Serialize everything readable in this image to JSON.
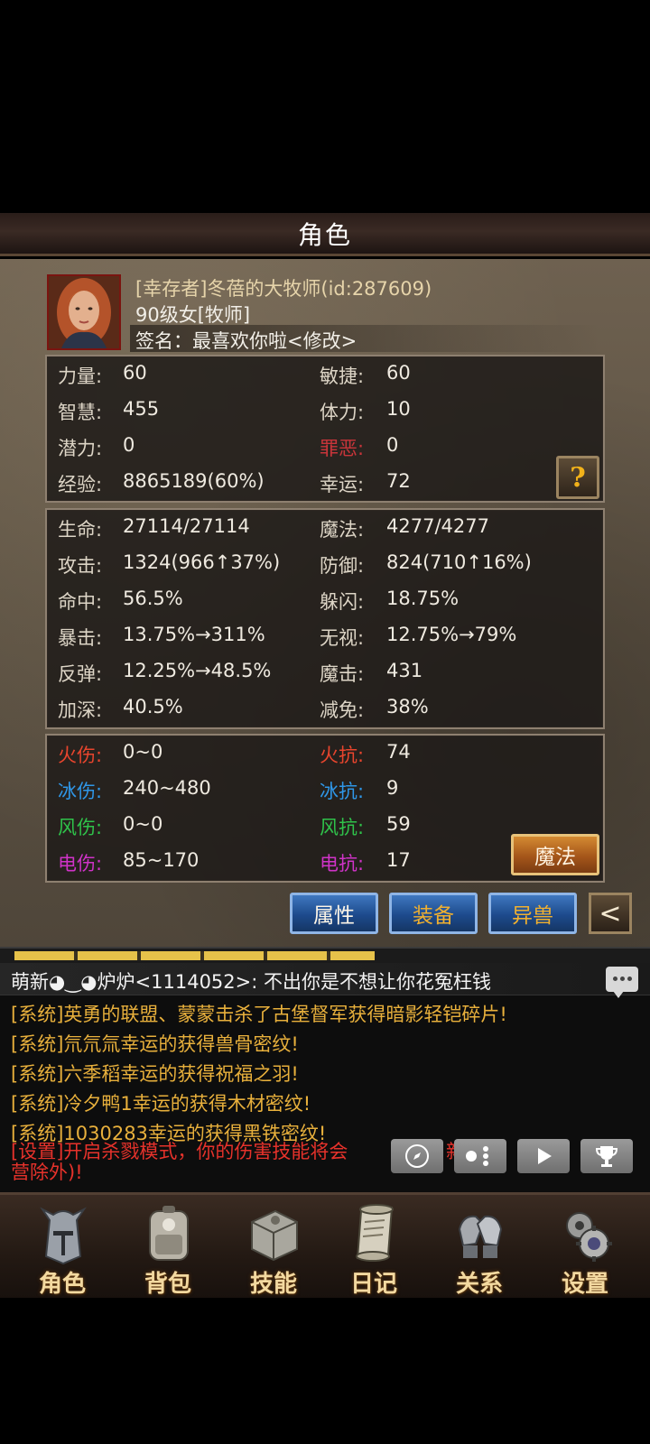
{
  "screen_title": "角色",
  "player": {
    "name": "[幸存者]冬蓓的大牧师(id:287609)",
    "level_class": "90级女[牧师]",
    "signature": "签名：最喜欢你啦<修改>"
  },
  "base_stats": [
    {
      "l1": "力量:",
      "v1": "60",
      "l2": "敏捷:",
      "v2": "60"
    },
    {
      "l1": "智慧:",
      "v1": "455",
      "l2": "体力:",
      "v2": "10"
    },
    {
      "l1": "潜力:",
      "v1": "0",
      "l2": "罪恶:",
      "v2": "0"
    },
    {
      "l1": "经验:",
      "v1": "8865189(60%)",
      "l2": "幸运:",
      "v2": "72"
    }
  ],
  "help_label": "?",
  "combat_stats": [
    {
      "l1": "生命:",
      "v1": "27114/27114",
      "l2": "魔法:",
      "v2": "4277/4277"
    },
    {
      "l1": "攻击:",
      "v1": "1324(966↑37%)",
      "l2": "防御:",
      "v2": "824(710↑16%)"
    },
    {
      "l1": "命中:",
      "v1": "56.5%",
      "l2": "躲闪:",
      "v2": "18.75%"
    },
    {
      "l1": "暴击:",
      "v1": "13.75%→311%",
      "l2": "无视:",
      "v2": "12.75%→79%"
    },
    {
      "l1": "反弹:",
      "v1": "12.25%→48.5%",
      "l2": "魔击:",
      "v2": "431"
    },
    {
      "l1": "加深:",
      "v1": "40.5%",
      "l2": "减免:",
      "v2": "38%"
    }
  ],
  "element_stats": [
    {
      "l1": "火伤:",
      "v1": "0~0",
      "l2": "火抗:",
      "v2": "74"
    },
    {
      "l1": "冰伤:",
      "v1": "240~480",
      "l2": "冰抗:",
      "v2": "9"
    },
    {
      "l1": "风伤:",
      "v1": "0~0",
      "l2": "风抗:",
      "v2": "59"
    },
    {
      "l1": "电伤:",
      "v1": "85~170",
      "l2": "电抗:",
      "v2": "17"
    }
  ],
  "magic_button": "魔法",
  "tabs": {
    "attributes": "属性",
    "equipment": "装备",
    "beast": "异兽"
  },
  "back_label": "<",
  "progress_fraction": 0.58,
  "chat": {
    "header": "萌新◕‿◕炉炉<1114052>:  不出你是不想让你花冤枉钱",
    "messages": [
      "[系统]英勇的联盟、蒙蒙击杀了古堡督军获得暗影轻铠碎片!",
      "[系统]氘氘氚幸运的获得兽骨密纹!",
      "[系统]六季稻幸运的获得祝福之羽!",
      "[系统]冷夕鸭1幸运的获得木材密纹!",
      "[系统]1030283幸运的获得黑铁密纹!"
    ],
    "warning_line1": "[设置]开启杀戮模式，你的伤害技能将会",
    "warning_line1_tail": "新",
    "warning_line2": "营除外)!"
  },
  "media_icons": [
    "compass-icon",
    "dots-icon",
    "play-icon",
    "trophy-icon"
  ],
  "nav": [
    {
      "label": "角色",
      "icon": "helmet-icon"
    },
    {
      "label": "背包",
      "icon": "backpack-icon"
    },
    {
      "label": "技能",
      "icon": "spellbook-icon"
    },
    {
      "label": "日记",
      "icon": "scroll-icon"
    },
    {
      "label": "关系",
      "icon": "gauntlets-icon"
    },
    {
      "label": "设置",
      "icon": "gear-icon"
    }
  ],
  "colors": {
    "fire": "#e8452d",
    "ice": "#2f97e8",
    "wind": "#2fc24a",
    "elec": "#d033c8",
    "evil": "#c8353a",
    "tab_blue": "#1d4a8c",
    "gold_text": "#f0b030"
  }
}
